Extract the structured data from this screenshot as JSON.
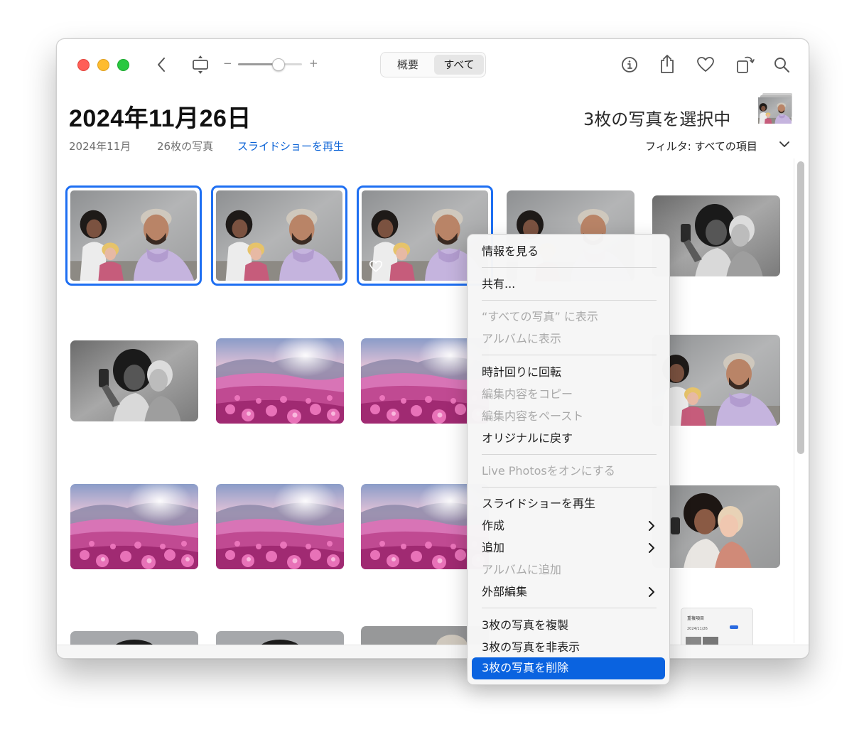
{
  "toolbar": {
    "tabs": [
      "概要",
      "すべて"
    ],
    "zoom_minus": "−",
    "zoom_plus": "+",
    "zoom_level": 0.62
  },
  "header": {
    "date_title": "2024年11月26日",
    "month": "2024年11月",
    "photo_count": "26枚の写真",
    "slideshow_link": "スライドショーを再生",
    "selection": "3枚の写真を選択中",
    "filter": "フィルタ: すべての項目"
  },
  "grid": {
    "selected_count": 3,
    "favorite_on_third": true
  },
  "context_menu": {
    "get_info": "情報を見る",
    "share": "共有...",
    "show_in_all_photos": "“すべての写真” に表示",
    "show_in_album": "アルバムに表示",
    "rotate_clockwise": "時計回りに回転",
    "copy_edits": "編集内容をコピー",
    "paste_edits": "編集内容をペースト",
    "revert_to_original": "オリジナルに戻す",
    "turn_on_live_photos": "Live Photosをオンにする",
    "play_slideshow": "スライドショーを再生",
    "create": "作成",
    "add_to": "追加",
    "add_to_album": "アルバムに追加",
    "edit_with": "外部編集",
    "duplicate": "3枚の写真を複製",
    "hide": "3枚の写真を非表示",
    "delete": "3枚の写真を削除"
  },
  "mini_screenshot": {
    "title": "重複項目",
    "date": "2024/11/26"
  },
  "colors": {
    "accent": "#1e6ff2",
    "link": "#0a62d6",
    "menu_highlight": "#0a63e0"
  }
}
